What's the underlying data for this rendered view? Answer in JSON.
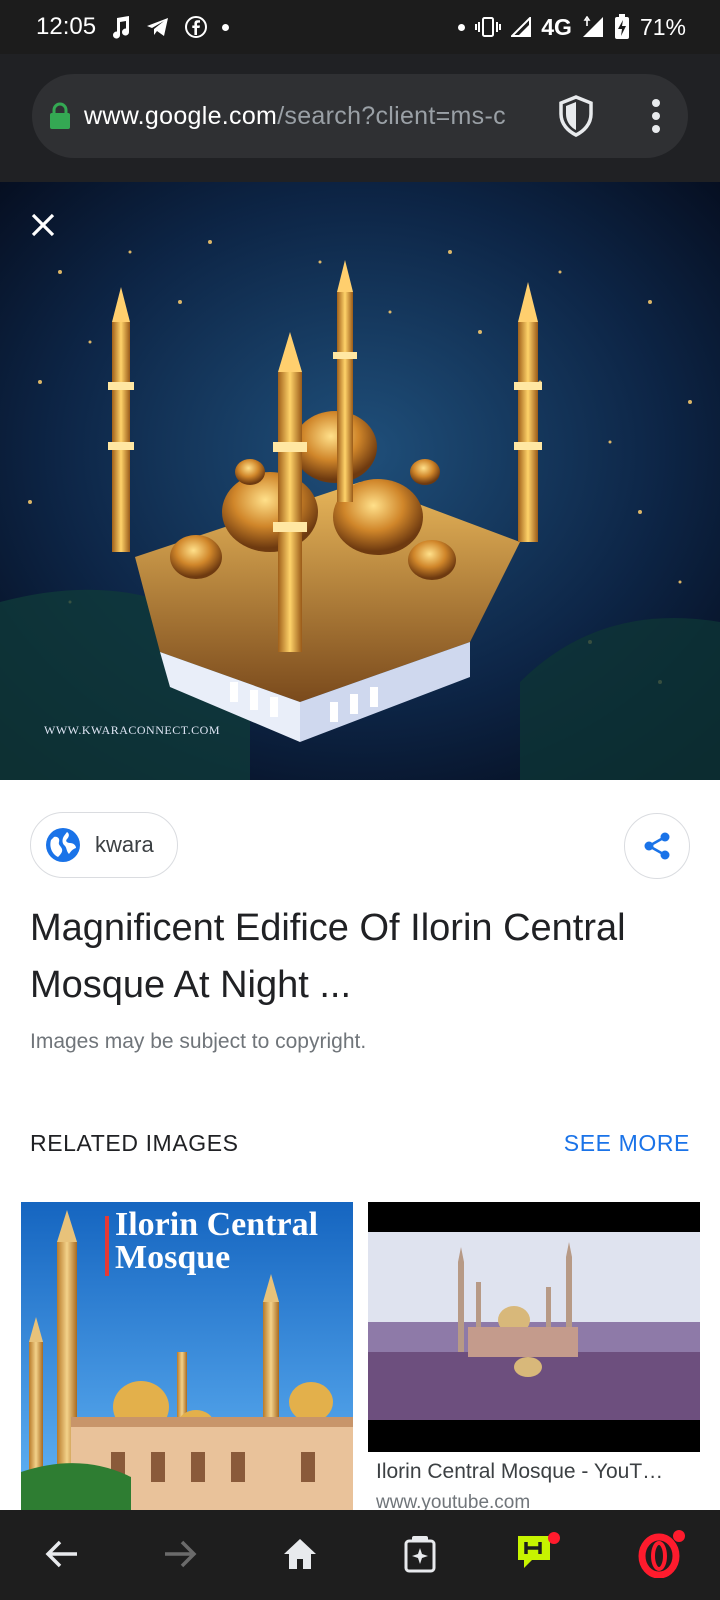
{
  "status_bar": {
    "time": "12:05",
    "network": "4G",
    "battery": "71%",
    "icons": [
      "music-note-icon",
      "telegram-icon",
      "facebook-icon",
      "vibrate-icon",
      "signal-icon",
      "battery-charging-icon"
    ]
  },
  "browser": {
    "url_host": "www.google.com",
    "url_path": "/search?client=ms-c",
    "icons": [
      "lock-icon",
      "shield-icon",
      "more-vert-icon"
    ]
  },
  "viewer": {
    "hero_watermark": "WWW.KWARACONNECT.COM",
    "source_label": "kwara",
    "title": "Magnificent Edifice Of Ilorin Central Mosque At Night ...",
    "copyright_note": "Images may be subject to copyright."
  },
  "related": {
    "header": "RELATED IMAGES",
    "see_more": "SEE MORE",
    "items": [
      {
        "overlay_title": "Ilorin Central Mosque"
      },
      {
        "caption": "Ilorin Central Mosque - YouT…",
        "domain": "www.youtube.com"
      }
    ]
  },
  "bottom_nav": {
    "icons": [
      "back-arrow-icon",
      "forward-arrow-icon",
      "home-icon",
      "tabs-icon",
      "hype-icon",
      "opera-icon"
    ]
  },
  "colors": {
    "link_blue": "#1a73e8",
    "opera_red": "#ff1b2d",
    "hype_green": "#c7f400",
    "lock_green": "#34a853"
  }
}
